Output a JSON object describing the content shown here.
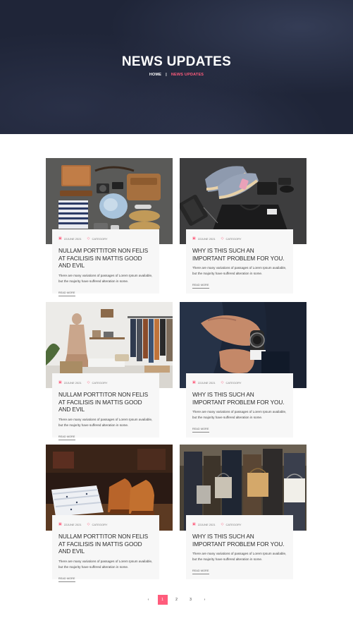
{
  "hero": {
    "title": "NEWS UPDATES",
    "breadcrumb_home": "HOME",
    "breadcrumb_sep": "|",
    "breadcrumb_current": "NEWS UPDATES"
  },
  "posts": [
    {
      "date": "22JUNE 2021",
      "category": "CATEGORY",
      "title": "NULLAM PORTTITOR NON FELIS AT FACILISIS IN MATTIS GOOD AND EVIL",
      "excerpt": "There are many variations of passages of Lorem Ipsum available, but the majority have suffered alteration in some.",
      "read_more": "READ MORE",
      "image": "flat-lay-accessories"
    },
    {
      "date": "22JUNE 2021",
      "category": "CATEGORY",
      "title": "WHY IS THIS SUCH AN IMPORTANT PROBLEM FOR YOU.",
      "excerpt": "There are many variations of passages of Lorem Ipsum available, but the majority have suffered alteration in some.",
      "read_more": "READ MORE",
      "image": "shoes-flat-lay"
    },
    {
      "date": "22JUNE 2021",
      "category": "CATEGORY",
      "title": "NULLAM PORTTITOR NON FELIS AT FACILISIS IN MATTIS GOOD AND EVIL",
      "excerpt": "There are many variations of passages of Lorem Ipsum available, but the majority have suffered alteration in some.",
      "read_more": "READ MORE",
      "image": "clothing-store"
    },
    {
      "date": "22JUNE 2021",
      "category": "CATEGORY",
      "title": "WHY IS THIS SUCH AN IMPORTANT PROBLEM FOR YOU.",
      "excerpt": "There are many variations of passages of Lorem Ipsum available, but the majority have suffered alteration in some.",
      "read_more": "READ MORE",
      "image": "wristwatch"
    },
    {
      "date": "22JUNE 2021",
      "category": "CATEGORY",
      "title": "NULLAM PORTTITOR NON FELIS AT FACILISIS IN MATTIS GOOD AND EVIL",
      "excerpt": "There are many variations of passages of Lorem Ipsum available, but the majority have suffered alteration in some.",
      "read_more": "READ MORE",
      "image": "shirts-and-shoes"
    },
    {
      "date": "22JUNE 2021",
      "category": "CATEGORY",
      "title": "WHY IS THIS SUCH AN IMPORTANT PROBLEM FOR YOU.",
      "excerpt": "There are many variations of passages of Lorem Ipsum available, but the majority have suffered alteration in some.",
      "read_more": "READ MORE",
      "image": "shopping-bags"
    }
  ],
  "icons": {
    "date": "calendar-icon",
    "category": "tag-icon"
  },
  "pagination": {
    "prev": "‹",
    "pages": [
      "1",
      "2",
      "3"
    ],
    "active_page": "1",
    "next": "›"
  },
  "colors": {
    "accent": "#ff5c7c",
    "hero_bg": "#1f2538",
    "card_bg": "#f7f7f7"
  }
}
